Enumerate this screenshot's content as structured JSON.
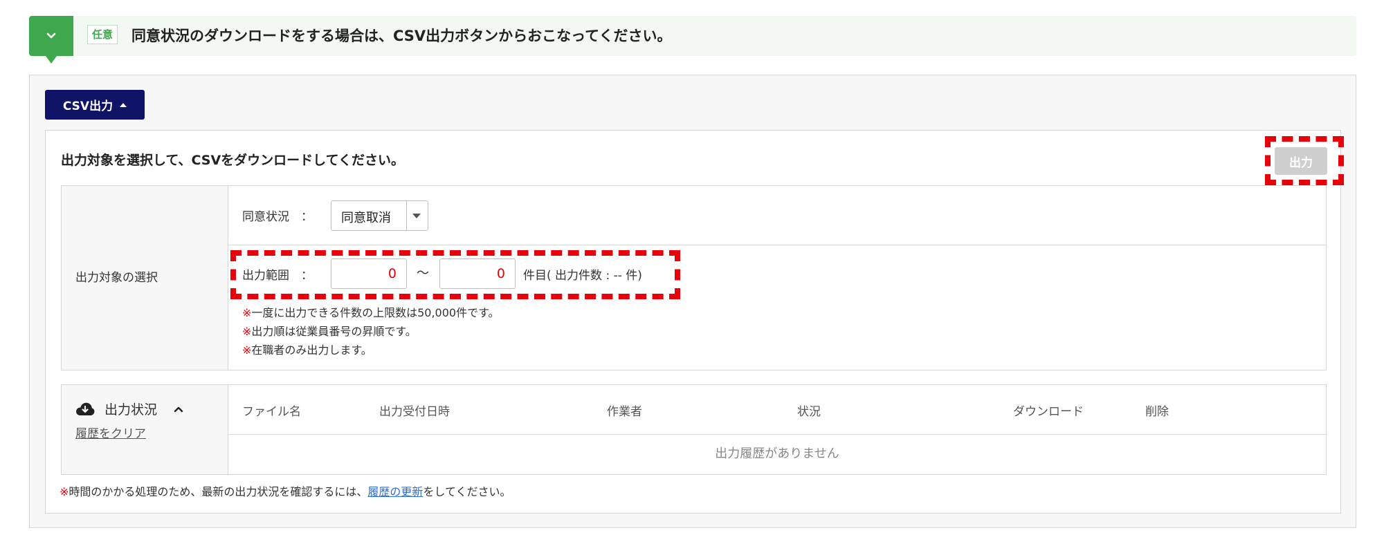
{
  "banner": {
    "badge": "任意",
    "text": "同意状況のダウンロードをする場合は、CSV出力ボタンからおこなってください。"
  },
  "panel": {
    "csv_button_label": "CSV出力",
    "heading": "出力対象を選択して、CSVをダウンロードしてください。",
    "output_button_label": "出力"
  },
  "selection": {
    "row_label": "出力対象の選択",
    "consent_label": "同意状況　：",
    "consent_value": "同意取消",
    "range_label": "出力範囲　：",
    "range_from": "0",
    "range_to": "0",
    "tilde": "～",
    "count_text": "件目( 出力件数 : -- 件)",
    "note_mark": "※",
    "notes": [
      "一度に出力できる件数の上限数は50,000件です。",
      "出力順は従業員番号の昇順です。",
      "在職者のみ出力します。"
    ]
  },
  "status": {
    "title": "出力状況",
    "clear_label": "履歴をクリア",
    "columns": [
      "ファイル名",
      "出力受付日時",
      "作業者",
      "状況",
      "ダウンロード",
      "削除"
    ],
    "empty_message": "出力履歴がありません",
    "footer_prefix": "時間のかかる処理のため、最新の出力状況を確認するには、",
    "footer_link": "履歴の更新",
    "footer_suffix": "をしてください。"
  },
  "icons": {
    "banner_toggle": "chevron-down-icon",
    "csv_button": "caret-up-icon",
    "select": "caret-down-icon",
    "status": "cloud-download-icon",
    "status_toggle": "chevron-up-icon"
  },
  "colors": {
    "accent_green": "#3fa84c",
    "navy": "#0f1466",
    "highlight_red": "#e8000b",
    "link_blue": "#2e6fd1"
  }
}
